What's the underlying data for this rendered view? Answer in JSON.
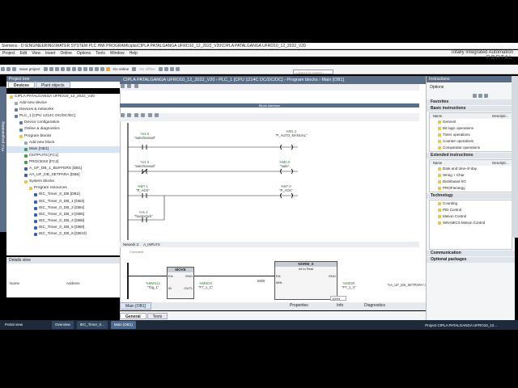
{
  "window": {
    "title": "Siemens  -  D:\\ENGINEERING\\WATER SYSTEM PLC HMI PROGRAM\\cipla\\CIPLA PATALGANGA UFRO10_12_2022_V20\\CIPLA PATALGANGA UFRO10_12_2022_V20"
  },
  "menu": [
    "Project",
    "Edit",
    "View",
    "Insert",
    "Online",
    "Options",
    "Tools",
    "Window",
    "Help"
  ],
  "brand": {
    "line1": "Totally Integrated Automation",
    "line2": "PORTAL"
  },
  "toolbar": {
    "save_label": "Save project",
    "go_online": "Go online",
    "go_offline": "Go offline",
    "search_placeholder": "<Search in project>"
  },
  "project_tree": {
    "header": "Project tree",
    "tab_devices": "Devices",
    "tab_plant": "Plant objects",
    "items": [
      {
        "label": "CIPLA PATALGANGA UFRO10_12_2022_V20",
        "icon": "project-icon",
        "indent": 0
      },
      {
        "label": "Add new device",
        "icon": "add-icon",
        "indent": 1
      },
      {
        "label": "Devices & networks",
        "icon": "network-icon",
        "indent": 1
      },
      {
        "label": "PLC_1 [CPU 1214C DC/DC/DC]",
        "icon": "device-icon",
        "indent": 1
      },
      {
        "label": "Device configuration",
        "icon": "device-icon",
        "indent": 2
      },
      {
        "label": "Online & diagnostics",
        "icon": "device-icon",
        "indent": 2
      },
      {
        "label": "Program blocks",
        "icon": "folder-icon",
        "indent": 2
      },
      {
        "label": "Add new block",
        "icon": "add-icon",
        "indent": 3
      },
      {
        "label": "Main [OB1]",
        "icon": "block-icon",
        "indent": 3,
        "selected": true
      },
      {
        "label": "OUTPUTS [FC1]",
        "icon": "block-icon",
        "indent": 3
      },
      {
        "label": "PROCESS [FC2]",
        "icon": "block-icon",
        "indent": 3
      },
      {
        "label": "A_UF_DB_1_BUFFERS [DB1]",
        "icon": "db-icon",
        "indent": 3
      },
      {
        "label": "AA_UF_DB_SETPARA [DB6]",
        "icon": "db-icon",
        "indent": 3
      },
      {
        "label": "System blocks",
        "icon": "folder-icon",
        "indent": 3
      },
      {
        "label": "Program resources",
        "icon": "folder-icon",
        "indent": 4
      },
      {
        "label": "IEC_Timer_0_DB [DB2]",
        "icon": "db-icon",
        "indent": 5
      },
      {
        "label": "IEC_Timer_0_DB_1 [DB3]",
        "icon": "db-icon",
        "indent": 5
      },
      {
        "label": "IEC_Timer_0_DB_2 [DB4]",
        "icon": "db-icon",
        "indent": 5
      },
      {
        "label": "IEC_Timer_0_DB_3 [DB5]",
        "icon": "db-icon",
        "indent": 5
      },
      {
        "label": "IEC_Timer_0_DB_4 [DB8]",
        "icon": "db-icon",
        "indent": 5
      },
      {
        "label": "IEC_Timer_0_DB_5 [DB9]",
        "icon": "db-icon",
        "indent": 5
      },
      {
        "label": "IEC_Timer_0_DB_6 [DB10]",
        "icon": "db-icon",
        "indent": 5
      }
    ]
  },
  "details_view": {
    "header": "Details view",
    "col_name": "Name",
    "col_address": "Address"
  },
  "breadcrumb": "CIPLA PATALGANGA UFRO10_12_2022_V20  ›  PLC_1 [CPU 1214C DC/DC/DC]  ›  Program blocks  ›  Main [OB1]",
  "editor": {
    "interface_label": "Block interface",
    "contacts": [
      {
        "addr": "%I1.5",
        "tag": "\"auto/manual\"",
        "type": "NO"
      },
      {
        "addr": "%M1.1",
        "tag": "\"P_AUTO_MANUAL\"",
        "type": "coil"
      },
      {
        "addr": "%I1.5",
        "tag": "\"auto/manual\"",
        "type": "NC"
      },
      {
        "addr": "%M0.0",
        "tag": "\"auto\"",
        "type": "coil"
      },
      {
        "addr": "%M7.1",
        "tag": "\"R_ACK\"",
        "type": "NO"
      },
      {
        "addr": "%M7.0",
        "tag": "\"P_ACK\"",
        "type": "coil"
      },
      {
        "addr": "%I1.4",
        "tag": "\"hooter/ack\"",
        "type": "NO"
      }
    ],
    "network3": {
      "label": "Network 3:",
      "title": "A_INPUTS",
      "comment": "Comment"
    },
    "move_block": {
      "title": "MOVE",
      "en": "EN",
      "eno": "ENO",
      "in_addr": "%MW112",
      "in_tag": "\"Trig_1\"",
      "in_pin": "IN",
      "out_pin": "OUT1",
      "out_addr": "%MW10",
      "out_tag": "\"FT_1_C\""
    },
    "norm_block": {
      "title": "NORM_X",
      "subtitle": "Int to Real",
      "en": "EN",
      "eno": "ENO",
      "min_val": "5600",
      "min_pin": "MIN",
      "out_addr": "%MD20",
      "out_tag": "\"FT_1_V\"",
      "ref": "\"AA_UF_DB_SETPARA\".FT_1_MA"
    },
    "zoom": "100%"
  },
  "bottom": {
    "main_tab": "Main [OB1]",
    "general": "General",
    "texts": "Texts",
    "properties": "Properties",
    "info": "Info",
    "diagnostics": "Diagnostics"
  },
  "instructions": {
    "header": "Instructions",
    "options": "Options",
    "favorites": "Favorites",
    "basic_header": "Basic instructions",
    "col_name": "Name",
    "col_desc": "Descripti...",
    "basic_items": [
      "General",
      "Bit logic operations",
      "Timer operations",
      "Counter operations",
      "Comparator operations"
    ],
    "extended_header": "Extended instructions",
    "extended_items": [
      "Date and time-of-day",
      "String + Char",
      "Distributed I/O",
      "PROFIenergy"
    ],
    "technology_header": "Technology",
    "technology_items": [
      "Counting",
      "PID Control",
      "Motion Control",
      "SINAMICS Motion Control"
    ],
    "communication": "Communication",
    "optional": "Optional packages"
  },
  "taskbar": {
    "portal_view": "Portal view",
    "tasks": [
      "Overview",
      "IEC_Timer_0...",
      "Main (OB1)"
    ],
    "status": "Project CIPLA PATALGANGA UFRO10_12..."
  },
  "side_tabs": {
    "left": "PLC programming"
  }
}
